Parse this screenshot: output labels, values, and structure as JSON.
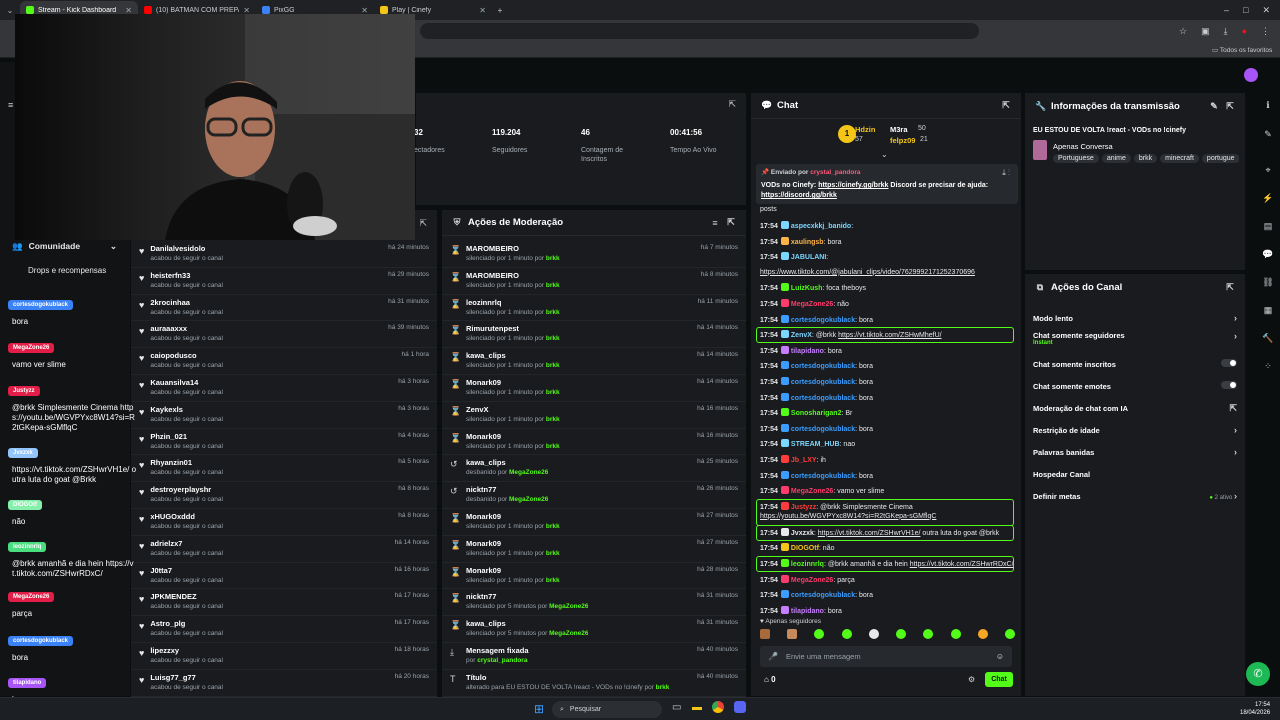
{
  "browser": {
    "tabs": [
      {
        "title": "Stream - Kick Dashboard",
        "color": "#53fc18"
      },
      {
        "title": "(10) BATMAN COM PREPARO V",
        "color": "#ff0000"
      },
      {
        "title": "PixGG",
        "color": "#3b82f6"
      },
      {
        "title": "Play | Cinefy",
        "color": "#f5c518"
      }
    ],
    "bookmarks_label": "Todos os favoritos"
  },
  "stats": [
    {
      "value": "32",
      "label": "ectadores"
    },
    {
      "value": "119.204",
      "label": "Seguidores"
    },
    {
      "value": "46",
      "label": "Contagem de Inscritos"
    },
    {
      "value": "00:41:56",
      "label": "Tempo Ao Vivo"
    }
  ],
  "left_sidebar": {
    "community": "Comunidade",
    "drops": "Drops e recompensas"
  },
  "followers": {
    "rows": [
      {
        "name": "Danilalvesidolo",
        "sub": "acabou de seguir o canal",
        "time": "há 24 minutos"
      },
      {
        "name": "heisterfn33",
        "sub": "acabou de seguir o canal",
        "time": "há 29 minutos"
      },
      {
        "name": "2krocinhaa",
        "sub": "acabou de seguir o canal",
        "time": "há 31 minutos"
      },
      {
        "name": "auraaaxxx",
        "sub": "acabou de seguir o canal",
        "time": "há 39 minutos"
      },
      {
        "name": "caiopodusco",
        "sub": "acabou de seguir o canal",
        "time": "há 1 hora"
      },
      {
        "name": "Kauansilva14",
        "sub": "acabou de seguir o canal",
        "time": "há 3 horas"
      },
      {
        "name": "Kaykexls",
        "sub": "acabou de seguir o canal",
        "time": "há 3 horas"
      },
      {
        "name": "Phzin_021",
        "sub": "acabou de seguir o canal",
        "time": "há 4 horas"
      },
      {
        "name": "Rhyanzin01",
        "sub": "acabou de seguir o canal",
        "time": "há 5 horas"
      },
      {
        "name": "destroyerplayshr",
        "sub": "acabou de seguir o canal",
        "time": "há 8 horas"
      },
      {
        "name": "xHUGOxddd",
        "sub": "acabou de seguir o canal",
        "time": "há 8 horas"
      },
      {
        "name": "adrielzx7",
        "sub": "acabou de seguir o canal",
        "time": "há 14 horas"
      },
      {
        "name": "J0tta7",
        "sub": "acabou de seguir o canal",
        "time": "há 16 horas"
      },
      {
        "name": "JPKMENDEZ",
        "sub": "acabou de seguir o canal",
        "time": "há 17 horas"
      },
      {
        "name": "Astro_plg",
        "sub": "acabou de seguir o canal",
        "time": "há 17 horas"
      },
      {
        "name": "lipezzxy",
        "sub": "acabou de seguir o canal",
        "time": "há 18 horas"
      },
      {
        "name": "Luisg77_g77",
        "sub": "acabou de seguir o canal",
        "time": "há 20 horas"
      }
    ]
  },
  "moderation": {
    "title": "Ações de Moderação",
    "rows": [
      {
        "icon": "⌛",
        "name": "MAROMBEIRO",
        "sub": "silenciado por 1 minuto por",
        "by": "brkk",
        "time": "há 7 minutos"
      },
      {
        "icon": "⌛",
        "name": "MAROMBEIRO",
        "sub": "silenciado por 1 minuto por",
        "by": "brkk",
        "time": "há 8 minutos"
      },
      {
        "icon": "⌛",
        "name": "leozinnrlq",
        "sub": "silenciado por 1 minuto por",
        "by": "brkk",
        "time": "há 11 minutos"
      },
      {
        "icon": "⌛",
        "name": "Rimurutenpest",
        "sub": "silenciado por 1 minuto por",
        "by": "brkk",
        "time": "há 14 minutos"
      },
      {
        "icon": "⌛",
        "name": "kawa_clips",
        "sub": "silenciado por 1 minuto por",
        "by": "brkk",
        "time": "há 14 minutos"
      },
      {
        "icon": "⌛",
        "name": "Monark09",
        "sub": "silenciado por 1 minuto por",
        "by": "brkk",
        "time": "há 14 minutos"
      },
      {
        "icon": "⌛",
        "name": "ZenvX",
        "sub": "silenciado por 1 minuto por",
        "by": "brkk",
        "time": "há 16 minutos"
      },
      {
        "icon": "⌛",
        "name": "Monark09",
        "sub": "silenciado por 1 minuto por",
        "by": "brkk",
        "time": "há 16 minutos"
      },
      {
        "icon": "↺",
        "name": "kawa_clips",
        "sub": "desbanido por",
        "by": "MegaZone26",
        "time": "há 25 minutos"
      },
      {
        "icon": "↺",
        "name": "nicktn77",
        "sub": "desbanido por",
        "by": "MegaZone26",
        "time": "há 26 minutos"
      },
      {
        "icon": "⌛",
        "name": "Monark09",
        "sub": "silenciado por 1 minuto por",
        "by": "brkk",
        "time": "há 27 minutos"
      },
      {
        "icon": "⌛",
        "name": "Monark09",
        "sub": "silenciado por 1 minuto por",
        "by": "brkk",
        "time": "há 27 minutos"
      },
      {
        "icon": "⌛",
        "name": "Monark09",
        "sub": "silenciado por 1 minuto por",
        "by": "brkk",
        "time": "há 28 minutos"
      },
      {
        "icon": "⌛",
        "name": "nicktn77",
        "sub": "silenciado por 5 minutos por",
        "by": "MegaZone26",
        "time": "há 31 minutos"
      },
      {
        "icon": "⌛",
        "name": "kawa_clips",
        "sub": "silenciado por 5 minutos por",
        "by": "MegaZone26",
        "time": "há 31 minutos"
      },
      {
        "icon": "⤓",
        "name": "Mensagem fixada",
        "sub": "por",
        "by": "crystal_pandora",
        "time": "há 40 minutos"
      },
      {
        "icon": "T",
        "name": "Título",
        "sub": "alterado para EU ESTOU DE VOLTA !react - VODs no !cinefy por",
        "by": "brkk",
        "time": "há 40 minutos"
      }
    ]
  },
  "chat": {
    "title": "Chat",
    "leaderboard": {
      "first": "Hdzin",
      "first_score": "57",
      "second": "M3ra",
      "second_score": "50",
      "third": "felpz09",
      "third_score": "21"
    },
    "pinned_by_label": "Enviado por",
    "pinned_user": "crystal_pandora",
    "pinned_text": "VODs no Cinefy:",
    "pinned_link": "https://cinefy.gg/brkk",
    "pinned_rest": "Discord se precisar de ajuda:",
    "pinned_link2": "https://discord.gg/brkk",
    "posts": "posts",
    "messages": [
      {
        "ts": "17:54",
        "user": "aspecxkkj_banido",
        "color": "#7ad7ff",
        "text": ""
      },
      {
        "ts": "17:54",
        "user": "xaulingsb",
        "color": "#ffb347",
        "text": "bora"
      },
      {
        "ts": "17:54",
        "user": "JABULANI",
        "color": "#7ad7ff",
        "text": ""
      },
      {
        "ts": "",
        "user": "",
        "color": "#fff",
        "text": "",
        "link": "https://www.tiktok.com/@jabulani_clips/video/7629992171252370696"
      },
      {
        "ts": "17:54",
        "user": "LuizKush",
        "color": "#53fc18",
        "text": "foca theboys"
      },
      {
        "ts": "17:54",
        "user": "MegaZone26",
        "color": "#ff3b6b",
        "text": "não"
      },
      {
        "ts": "17:54",
        "user": "cortesdogokublack",
        "color": "#3b9dff",
        "text": "bora"
      },
      {
        "ts": "17:54",
        "user": "ZenvX",
        "color": "#7ad7ff",
        "text": "@brkk",
        "link": "https://vt.tiktok.com/ZSHwMhefU/"
      },
      {
        "ts": "17:54",
        "user": "tilapidano",
        "color": "#c77dff",
        "text": "bora"
      },
      {
        "ts": "17:54",
        "user": "cortesdogokublack",
        "color": "#3b9dff",
        "text": "bora"
      },
      {
        "ts": "17:54",
        "user": "cortesdogokublack",
        "color": "#3b9dff",
        "text": "bora"
      },
      {
        "ts": "17:54",
        "user": "cortesdogokublack",
        "color": "#3b9dff",
        "text": "bora"
      },
      {
        "ts": "17:54",
        "user": "Sonosharigan2",
        "color": "#53fc18",
        "text": "Br"
      },
      {
        "ts": "17:54",
        "user": "cortesdogokublack",
        "color": "#3b9dff",
        "text": "bora"
      },
      {
        "ts": "17:54",
        "user": "STREAM_HUB",
        "color": "#7ad7ff",
        "text": "nao"
      },
      {
        "ts": "17:54",
        "user": "Jb_LXY",
        "color": "#ff3b3b",
        "text": "ih"
      },
      {
        "ts": "17:54",
        "user": "cortesdogokublack",
        "color": "#3b9dff",
        "text": "bora"
      },
      {
        "ts": "17:54",
        "user": "MegaZone26",
        "color": "#ff3b6b",
        "text": "vamo ver slime"
      },
      {
        "ts": "17:54",
        "user": "Justyzz",
        "color": "#ff3b3b",
        "text": "@brkk Simplesmente Cinema",
        "link2": "https://youtu.be/WGVPYxc8W14?si=R2tGKepa-sGMflqC"
      },
      {
        "ts": "17:54",
        "user": "Jvxzxk",
        "color": "#e6e8ea",
        "text": "",
        "link": "https://vt.tiktok.com/ZSHwrVH1e/",
        "after": "outra luta do goat @brkk"
      },
      {
        "ts": "17:54",
        "user": "DIOGOtf",
        "color": "#f5c518",
        "text": "não"
      },
      {
        "ts": "17:54",
        "user": "leozinnrlq",
        "color": "#53fc18",
        "text": "@brkk amanhã e dia hein",
        "link": "https://vt.tiktok.com/ZSHwrRDxC/"
      },
      {
        "ts": "17:54",
        "user": "MegaZone26",
        "color": "#ff3b6b",
        "text": "parça"
      },
      {
        "ts": "17:54",
        "user": "cortesdogokublack",
        "color": "#3b9dff",
        "text": "bora"
      },
      {
        "ts": "17:54",
        "user": "tilapidano",
        "color": "#c77dff",
        "text": "bora"
      }
    ],
    "followers_only": "Apenas seguidores",
    "input_placeholder": "Envie uma mensagem",
    "count": "0",
    "send_label": "Chat"
  },
  "stream_info": {
    "title": "Informações da transmissão",
    "stream_title": "EU ESTOU DE VOLTA !react - VODs no !cinefy",
    "category": "Apenas Conversa",
    "tags": [
      "Portuguese",
      "anime",
      "brkk",
      "minecraft",
      "portugue"
    ]
  },
  "channel_actions": {
    "title": "Ações do Canal",
    "slow": "Modo lento",
    "followers_only": "Chat somente seguidores",
    "followers_only_sub": "Instant",
    "subs_only": "Chat somente inscritos",
    "emotes_only": "Chat somente emotes",
    "ai_mod": "Moderação de chat com IA",
    "age": "Restrição de idade",
    "banned_words": "Palavras banidas",
    "host": "Hospedar Canal",
    "goals": "Definir metas",
    "goals_status": "2 ativo"
  },
  "overlay_chat": [
    {
      "user": "cortesdogokublack",
      "color": "#3b82f6",
      "text": "bora"
    },
    {
      "user": "MegaZone26",
      "color": "#e11d48",
      "text": "vamo ver slime"
    },
    {
      "user": "Justyzz",
      "color": "#e11d48",
      "text": "@brkk Simplesmente Cinema https://youtu.be/WGVPYxc8W14?si=R2tGKepa-sGMflqC"
    },
    {
      "user": "Jvxzxk",
      "color": "#93c5fd",
      "text": "https://vt.tiktok.com/ZSHwrVH1e/ outra luta do goat @Brkk"
    },
    {
      "user": "DIOGOtf",
      "color": "#86efac",
      "text": "não"
    },
    {
      "user": "leozinnrlq",
      "color": "#4ade80",
      "text": "@brkk amanhã e dia hein https://vt.tiktok.com/ZSHwrRDxC/"
    },
    {
      "user": "MegaZone26",
      "color": "#e11d48",
      "text": "parça"
    },
    {
      "user": "cortesdogokublack",
      "color": "#3b82f6",
      "text": "bora"
    },
    {
      "user": "tilapidano",
      "color": "#a855f7",
      "text": "bora"
    }
  ],
  "taskbar": {
    "search": "Pesquisar",
    "time": "17:54",
    "date": "18/04/2026"
  }
}
